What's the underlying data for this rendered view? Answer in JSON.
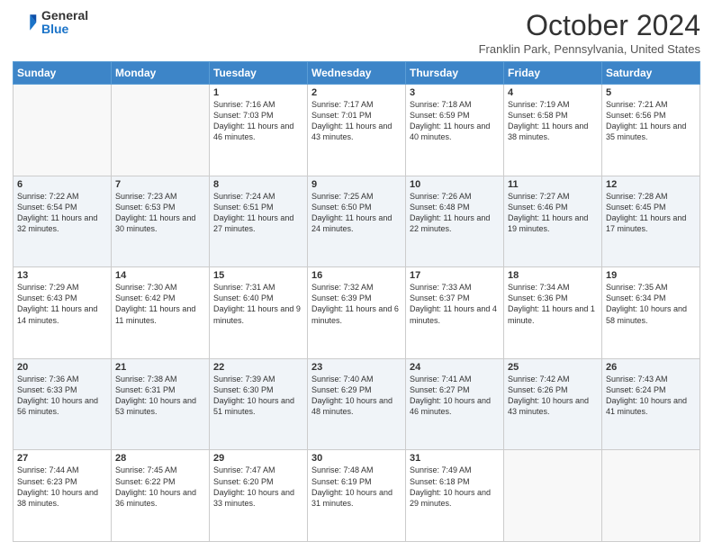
{
  "logo": {
    "general": "General",
    "blue": "Blue"
  },
  "header": {
    "month": "October 2024",
    "location": "Franklin Park, Pennsylvania, United States"
  },
  "days_of_week": [
    "Sunday",
    "Monday",
    "Tuesday",
    "Wednesday",
    "Thursday",
    "Friday",
    "Saturday"
  ],
  "weeks": [
    [
      {
        "day": "",
        "empty": true
      },
      {
        "day": "",
        "empty": true
      },
      {
        "day": "1",
        "sunrise": "7:16 AM",
        "sunset": "7:03 PM",
        "daylight": "11 hours and 46 minutes."
      },
      {
        "day": "2",
        "sunrise": "7:17 AM",
        "sunset": "7:01 PM",
        "daylight": "11 hours and 43 minutes."
      },
      {
        "day": "3",
        "sunrise": "7:18 AM",
        "sunset": "6:59 PM",
        "daylight": "11 hours and 40 minutes."
      },
      {
        "day": "4",
        "sunrise": "7:19 AM",
        "sunset": "6:58 PM",
        "daylight": "11 hours and 38 minutes."
      },
      {
        "day": "5",
        "sunrise": "7:21 AM",
        "sunset": "6:56 PM",
        "daylight": "11 hours and 35 minutes."
      }
    ],
    [
      {
        "day": "6",
        "sunrise": "7:22 AM",
        "sunset": "6:54 PM",
        "daylight": "11 hours and 32 minutes."
      },
      {
        "day": "7",
        "sunrise": "7:23 AM",
        "sunset": "6:53 PM",
        "daylight": "11 hours and 30 minutes."
      },
      {
        "day": "8",
        "sunrise": "7:24 AM",
        "sunset": "6:51 PM",
        "daylight": "11 hours and 27 minutes."
      },
      {
        "day": "9",
        "sunrise": "7:25 AM",
        "sunset": "6:50 PM",
        "daylight": "11 hours and 24 minutes."
      },
      {
        "day": "10",
        "sunrise": "7:26 AM",
        "sunset": "6:48 PM",
        "daylight": "11 hours and 22 minutes."
      },
      {
        "day": "11",
        "sunrise": "7:27 AM",
        "sunset": "6:46 PM",
        "daylight": "11 hours and 19 minutes."
      },
      {
        "day": "12",
        "sunrise": "7:28 AM",
        "sunset": "6:45 PM",
        "daylight": "11 hours and 17 minutes."
      }
    ],
    [
      {
        "day": "13",
        "sunrise": "7:29 AM",
        "sunset": "6:43 PM",
        "daylight": "11 hours and 14 minutes."
      },
      {
        "day": "14",
        "sunrise": "7:30 AM",
        "sunset": "6:42 PM",
        "daylight": "11 hours and 11 minutes."
      },
      {
        "day": "15",
        "sunrise": "7:31 AM",
        "sunset": "6:40 PM",
        "daylight": "11 hours and 9 minutes."
      },
      {
        "day": "16",
        "sunrise": "7:32 AM",
        "sunset": "6:39 PM",
        "daylight": "11 hours and 6 minutes."
      },
      {
        "day": "17",
        "sunrise": "7:33 AM",
        "sunset": "6:37 PM",
        "daylight": "11 hours and 4 minutes."
      },
      {
        "day": "18",
        "sunrise": "7:34 AM",
        "sunset": "6:36 PM",
        "daylight": "11 hours and 1 minute."
      },
      {
        "day": "19",
        "sunrise": "7:35 AM",
        "sunset": "6:34 PM",
        "daylight": "10 hours and 58 minutes."
      }
    ],
    [
      {
        "day": "20",
        "sunrise": "7:36 AM",
        "sunset": "6:33 PM",
        "daylight": "10 hours and 56 minutes."
      },
      {
        "day": "21",
        "sunrise": "7:38 AM",
        "sunset": "6:31 PM",
        "daylight": "10 hours and 53 minutes."
      },
      {
        "day": "22",
        "sunrise": "7:39 AM",
        "sunset": "6:30 PM",
        "daylight": "10 hours and 51 minutes."
      },
      {
        "day": "23",
        "sunrise": "7:40 AM",
        "sunset": "6:29 PM",
        "daylight": "10 hours and 48 minutes."
      },
      {
        "day": "24",
        "sunrise": "7:41 AM",
        "sunset": "6:27 PM",
        "daylight": "10 hours and 46 minutes."
      },
      {
        "day": "25",
        "sunrise": "7:42 AM",
        "sunset": "6:26 PM",
        "daylight": "10 hours and 43 minutes."
      },
      {
        "day": "26",
        "sunrise": "7:43 AM",
        "sunset": "6:24 PM",
        "daylight": "10 hours and 41 minutes."
      }
    ],
    [
      {
        "day": "27",
        "sunrise": "7:44 AM",
        "sunset": "6:23 PM",
        "daylight": "10 hours and 38 minutes."
      },
      {
        "day": "28",
        "sunrise": "7:45 AM",
        "sunset": "6:22 PM",
        "daylight": "10 hours and 36 minutes."
      },
      {
        "day": "29",
        "sunrise": "7:47 AM",
        "sunset": "6:20 PM",
        "daylight": "10 hours and 33 minutes."
      },
      {
        "day": "30",
        "sunrise": "7:48 AM",
        "sunset": "6:19 PM",
        "daylight": "10 hours and 31 minutes."
      },
      {
        "day": "31",
        "sunrise": "7:49 AM",
        "sunset": "6:18 PM",
        "daylight": "10 hours and 29 minutes."
      },
      {
        "day": "",
        "empty": true
      },
      {
        "day": "",
        "empty": true
      }
    ]
  ]
}
